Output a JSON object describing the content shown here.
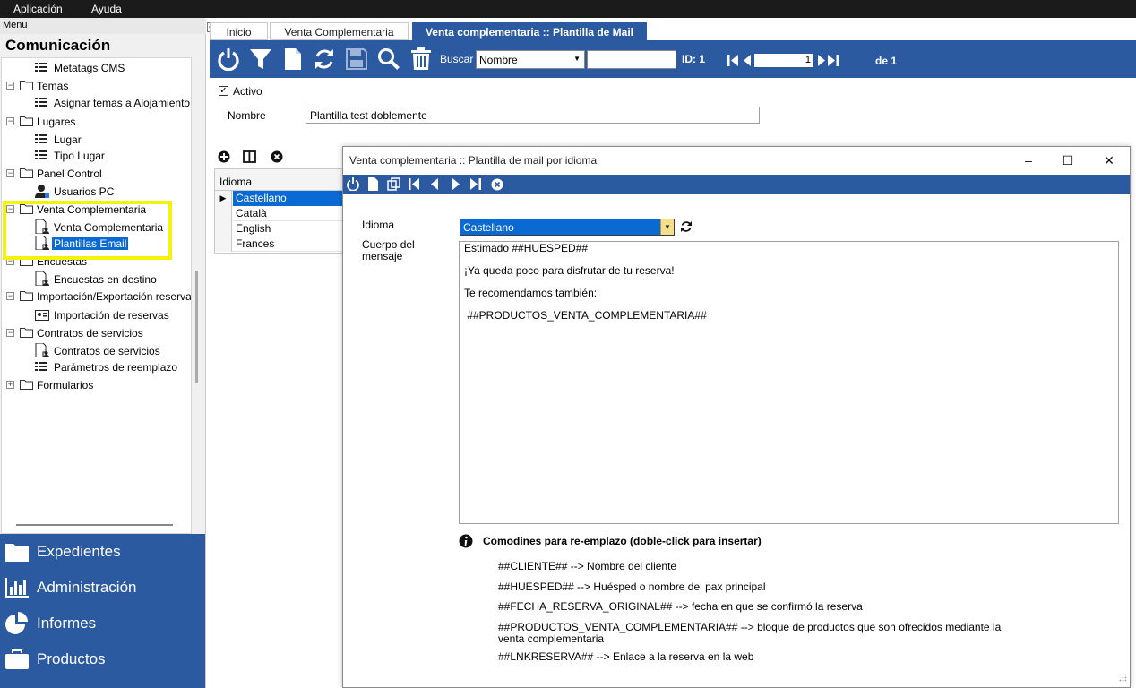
{
  "menubar": {
    "items": [
      "Aplicación",
      "Ayuda"
    ]
  },
  "leftpanel": {
    "header": "Menu",
    "section_title": "Comunicación",
    "tree": [
      {
        "label": "Metatags CMS",
        "type": "leaf",
        "icon": "list-icon"
      },
      {
        "label": "Temas",
        "type": "folder"
      },
      {
        "label": "Asignar temas a Alojamiento",
        "type": "leaf",
        "icon": "list-icon"
      },
      {
        "label": "Lugares",
        "type": "folder"
      },
      {
        "label": "Lugar",
        "type": "leaf",
        "icon": "list-icon"
      },
      {
        "label": "Tipo Lugar",
        "type": "leaf",
        "icon": "list-icon"
      },
      {
        "label": "Panel Control",
        "type": "folder"
      },
      {
        "label": "Usuarios PC",
        "type": "leaf",
        "icon": "user-icon"
      },
      {
        "label": "Venta Complementaria",
        "type": "folder"
      },
      {
        "label": "Venta Complementaria",
        "type": "leaf",
        "icon": "doc-user-icon"
      },
      {
        "label": "Plantillas Email",
        "type": "leaf",
        "icon": "doc-user-icon",
        "selected": true
      },
      {
        "label": "Encuestas",
        "type": "folder"
      },
      {
        "label": "Encuestas en destino",
        "type": "leaf",
        "icon": "doc-user-icon"
      },
      {
        "label": "Importación/Exportación reserva",
        "type": "folder"
      },
      {
        "label": "Importación de reservas",
        "type": "leaf",
        "icon": "card-icon"
      },
      {
        "label": "Contratos de servicios",
        "type": "folder"
      },
      {
        "label": "Contratos de servicios",
        "type": "leaf",
        "icon": "doc-user-icon"
      },
      {
        "label": "Parámetros de reemplazo",
        "type": "leaf",
        "icon": "list-icon"
      },
      {
        "label": "Formularios",
        "type": "folder-collapsed"
      }
    ],
    "nav": [
      "Expedientes",
      "Administración",
      "Informes",
      "Productos"
    ]
  },
  "tabs": [
    "Inicio",
    "Venta Complementaria",
    "Venta complementaria :: Plantilla de Mail"
  ],
  "toolbar": {
    "buscar_label": "Buscar",
    "buscar_option": "Nombre",
    "buscar_value": "",
    "id_label": "ID: 1",
    "page": "1",
    "de_label": "de 1"
  },
  "form": {
    "activo_label": "Activo",
    "nombre_label": "Nombre",
    "nombre_value": "Plantilla test doblemente"
  },
  "grid": {
    "header": "Idioma",
    "rows": [
      "Castellano",
      "Català",
      "English",
      "Frances"
    ]
  },
  "dialog": {
    "title": "Venta complementaria :: Plantilla de mail por idioma",
    "idioma_label": "Idioma",
    "idioma_value": "Castellano",
    "cuerpo_label": "Cuerpo del mensaje",
    "cuerpo_lines": [
      "Estimado  ##HUESPED##",
      "¡Ya queda poco para disfrutar de tu reserva!",
      "Te recomendamos también:",
      " ##PRODUCTOS_VENTA_COMPLEMENTARIA##"
    ],
    "comodines_title": "Comodines para re-emplazo (doble-click para insertar)",
    "comodines": [
      "##CLIENTE## --> Nombre del cliente",
      "##HUESPED## --> Huésped o nombre del pax principal",
      "##FECHA_RESERVA_ORIGINAL## --> fecha en que se confirmó la reserva",
      "##PRODUCTOS_VENTA_COMPLEMENTARIA## --> bloque de productos que son ofrecidos mediante la venta complementaria",
      "##LNKRESERVA## --> Enlace a la reserva en la web"
    ]
  },
  "colors": {
    "accent": "#2c5aa0",
    "selection": "#0a6ad4",
    "highlight": "#f7f20a"
  }
}
